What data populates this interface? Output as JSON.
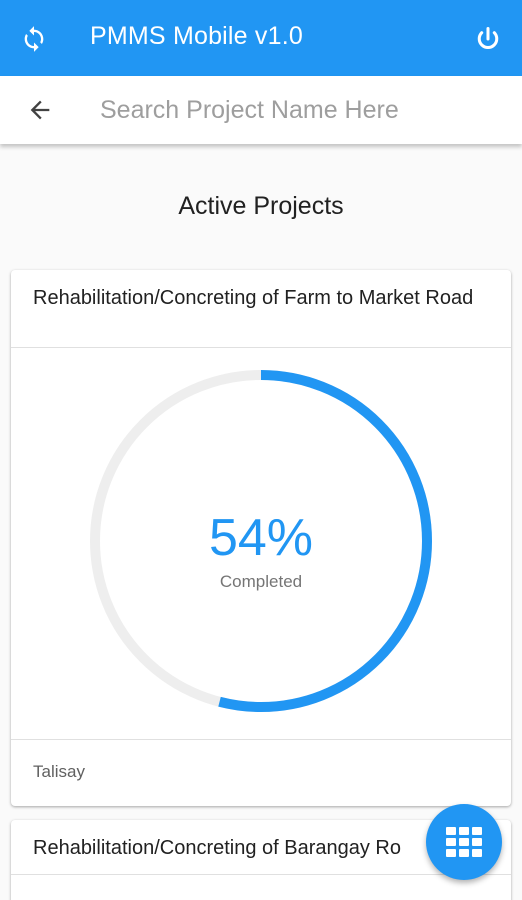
{
  "appbar": {
    "title": "PMMS Mobile v1.0",
    "refresh_icon": "refresh-icon",
    "power_icon": "power-icon",
    "color": "#2196f3"
  },
  "search": {
    "placeholder": "Search Project Name Here",
    "value": "",
    "back_icon": "arrow-back-icon"
  },
  "main": {
    "section_title": "Active Projects",
    "projects": [
      {
        "name": "Rehabilitation/Concreting of Farm to Market Road",
        "percent_text": "54%",
        "percent_value": 54,
        "status_label": "Completed",
        "location": "Talisay"
      },
      {
        "name": "Rehabilitation/Concreting of Barangay Ro"
      }
    ]
  },
  "fab": {
    "icon": "grid-apps-icon"
  },
  "colors": {
    "accent": "#2196f3",
    "track": "#eeeeee"
  }
}
